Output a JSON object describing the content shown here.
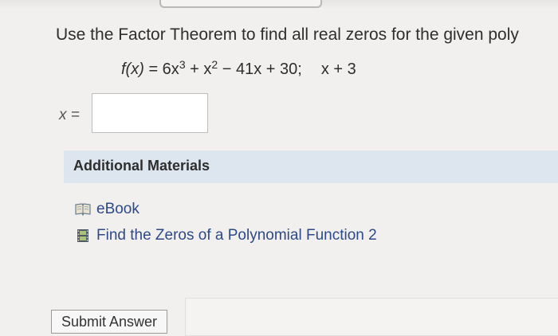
{
  "question": {
    "text": "Use the Factor Theorem to find all real zeros for the given poly"
  },
  "equation": {
    "fn": "f(x)",
    "rhs_part1": " = 6x",
    "exp1": "3",
    "rhs_part2": " + x",
    "exp2": "2",
    "rhs_part3": " − 41x + 30;",
    "factor": "x + 3"
  },
  "answer": {
    "label": "x =",
    "value": ""
  },
  "additional_materials": {
    "title": "Additional Materials",
    "items": [
      {
        "label": "eBook",
        "icon": "book-icon"
      },
      {
        "label": "Find the Zeros of a Polynomial Function 2",
        "icon": "film-icon"
      }
    ]
  },
  "actions": {
    "submit_label": "Submit Answer"
  }
}
